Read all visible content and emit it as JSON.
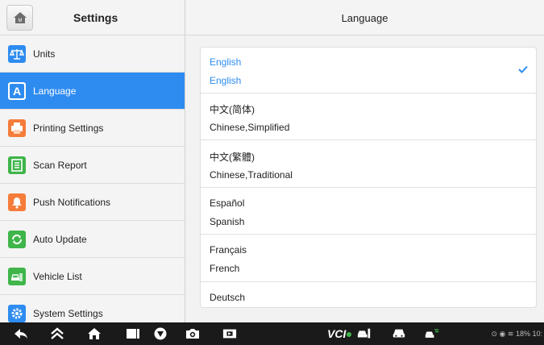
{
  "header": {
    "left_title": "Settings",
    "right_title": "Language",
    "home_icon_label": "M"
  },
  "sidebar": {
    "items": [
      {
        "label": "Units",
        "icon": "scale-icon",
        "color": "#2e8cf0",
        "active": false
      },
      {
        "label": "Language",
        "icon": "language-icon",
        "color": "#2e8cf0",
        "active": true
      },
      {
        "label": "Printing Settings",
        "icon": "printer-icon",
        "color": "#f57c3a",
        "active": false
      },
      {
        "label": "Scan Report",
        "icon": "report-icon",
        "color": "#3fb54a",
        "active": false
      },
      {
        "label": "Push Notifications",
        "icon": "bell-icon",
        "color": "#f57c3a",
        "active": false
      },
      {
        "label": "Auto Update",
        "icon": "refresh-icon",
        "color": "#3fb54a",
        "active": false
      },
      {
        "label": "Vehicle List",
        "icon": "vehicle-list-icon",
        "color": "#3fb54a",
        "active": false
      },
      {
        "label": "System Settings",
        "icon": "gear-icon",
        "color": "#2e8cf0",
        "active": false
      }
    ]
  },
  "languages": [
    {
      "native": "English",
      "english": "English",
      "selected": true
    },
    {
      "native": "中文(简体)",
      "english": "Chinese,Simplified",
      "selected": false
    },
    {
      "native": "中文(繁體)",
      "english": "Chinese,Traditional",
      "selected": false
    },
    {
      "native": "Español",
      "english": "Spanish",
      "selected": false
    },
    {
      "native": "Français",
      "english": "French",
      "selected": false
    },
    {
      "native": "Deutsch",
      "english": "",
      "selected": false
    }
  ],
  "navbar": {
    "vci_label": "VCI",
    "status_text": "18% 10:"
  },
  "colors": {
    "accent": "#2e8cf0",
    "sidebar_bg": "#f4f4f4",
    "navbar_bg": "#1a1a1a"
  }
}
